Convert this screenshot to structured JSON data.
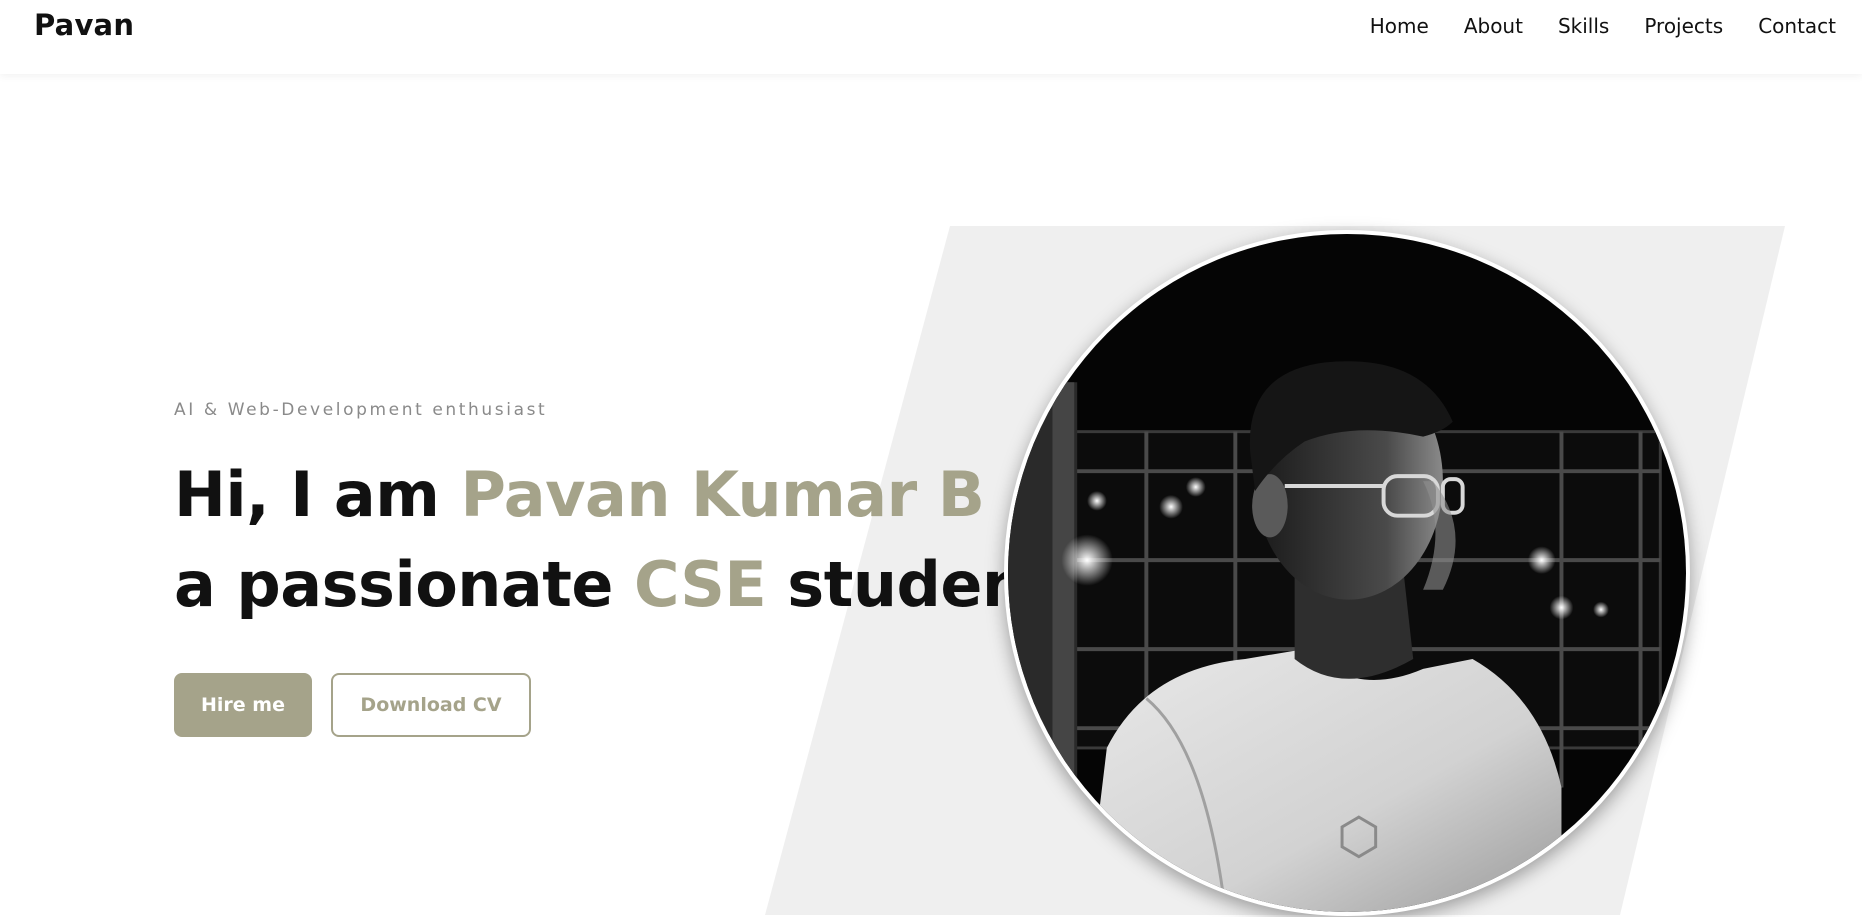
{
  "nav": {
    "brand": "Pavan",
    "links": [
      "Home",
      "About",
      "Skills",
      "Projects",
      "Contact"
    ]
  },
  "hero": {
    "tagline": "AI & Web-Development enthusiast",
    "line1_prefix": "Hi, I am ",
    "line1_name": "Pavan Kumar B",
    "line2_prefix": "a passionate ",
    "line2_accent": "CSE",
    "line2_suffix": " student",
    "hire_button": "Hire me",
    "cv_button": "Download CV",
    "photo_icon": "profile-photo"
  },
  "colors": {
    "accent": "#a5a38a",
    "text": "#111111",
    "muted": "#8a8a8a",
    "panel": "#efefef",
    "background": "#ffffff"
  }
}
